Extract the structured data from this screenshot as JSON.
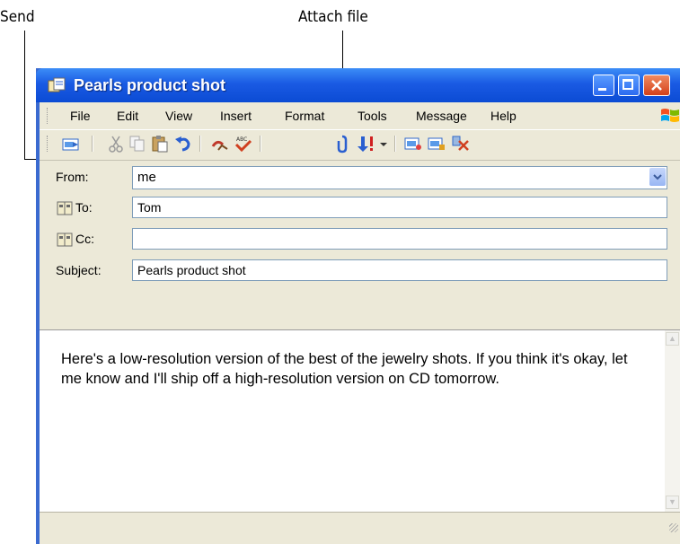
{
  "callouts": {
    "send": "Send",
    "attach": "Attach file"
  },
  "window": {
    "title": "Pearls product shot"
  },
  "menu": [
    "File",
    "Edit",
    "View",
    "Insert",
    "Format",
    "Tools",
    "Message",
    "Help"
  ],
  "toolbar": [
    "send",
    "cut",
    "copy",
    "paste",
    "undo",
    "check-names",
    "spelling",
    "attach",
    "priority",
    "sign",
    "encrypt",
    "work-offline"
  ],
  "fields": {
    "from_label": "From:",
    "from_value": "me",
    "to_label": "To:",
    "to_value": "Tom",
    "cc_label": "Cc:",
    "cc_value": "",
    "subject_label": "Subject:",
    "subject_value": "Pearls product shot"
  },
  "body": {
    "text": "Here's a low-resolution version of the best of the jewelry shots. If you think it's okay, let me know and I'll ship off a high-resolution version on CD tomorrow."
  },
  "colors": {
    "titlebar": "#0b4bd4",
    "chrome": "#ece9d8",
    "field_border": "#7f9db9"
  }
}
